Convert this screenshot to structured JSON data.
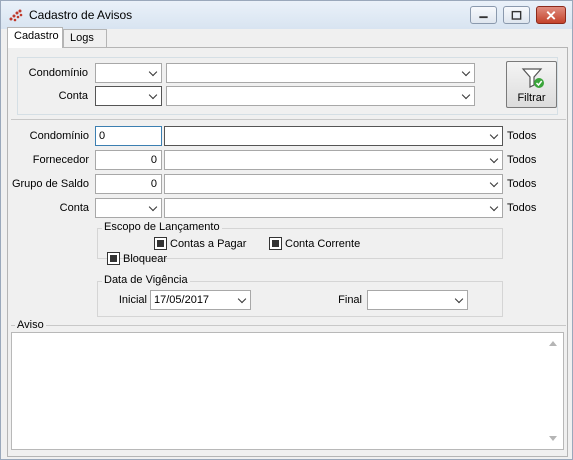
{
  "window": {
    "title": "Cadastro de Avisos"
  },
  "tabs": [
    {
      "label": "Cadastro"
    },
    {
      "label": "Logs"
    }
  ],
  "filter_section": {
    "condominio_label": "Condomínio",
    "conta_label": "Conta",
    "filter_button_label": "Filtrar"
  },
  "form": {
    "condominio_label": "Condomínio",
    "condominio_code": "0",
    "fornecedor_label": "Fornecedor",
    "fornecedor_code": "0",
    "grupo_saldo_label": "Grupo de Saldo",
    "grupo_saldo_code": "0",
    "conta_label": "Conta",
    "todos_label": "Todos"
  },
  "escopo": {
    "title": "Escopo de Lançamento",
    "contas_a_pagar": "Contas a Pagar",
    "conta_corrente": "Conta Corrente",
    "bloquear": "Bloquear"
  },
  "vigencia": {
    "title": "Data de Vigência",
    "inicial_label": "Inicial",
    "inicial_value": "17/05/2017",
    "final_label": "Final",
    "final_value": ""
  },
  "aviso": {
    "label": "Aviso",
    "value": ""
  }
}
